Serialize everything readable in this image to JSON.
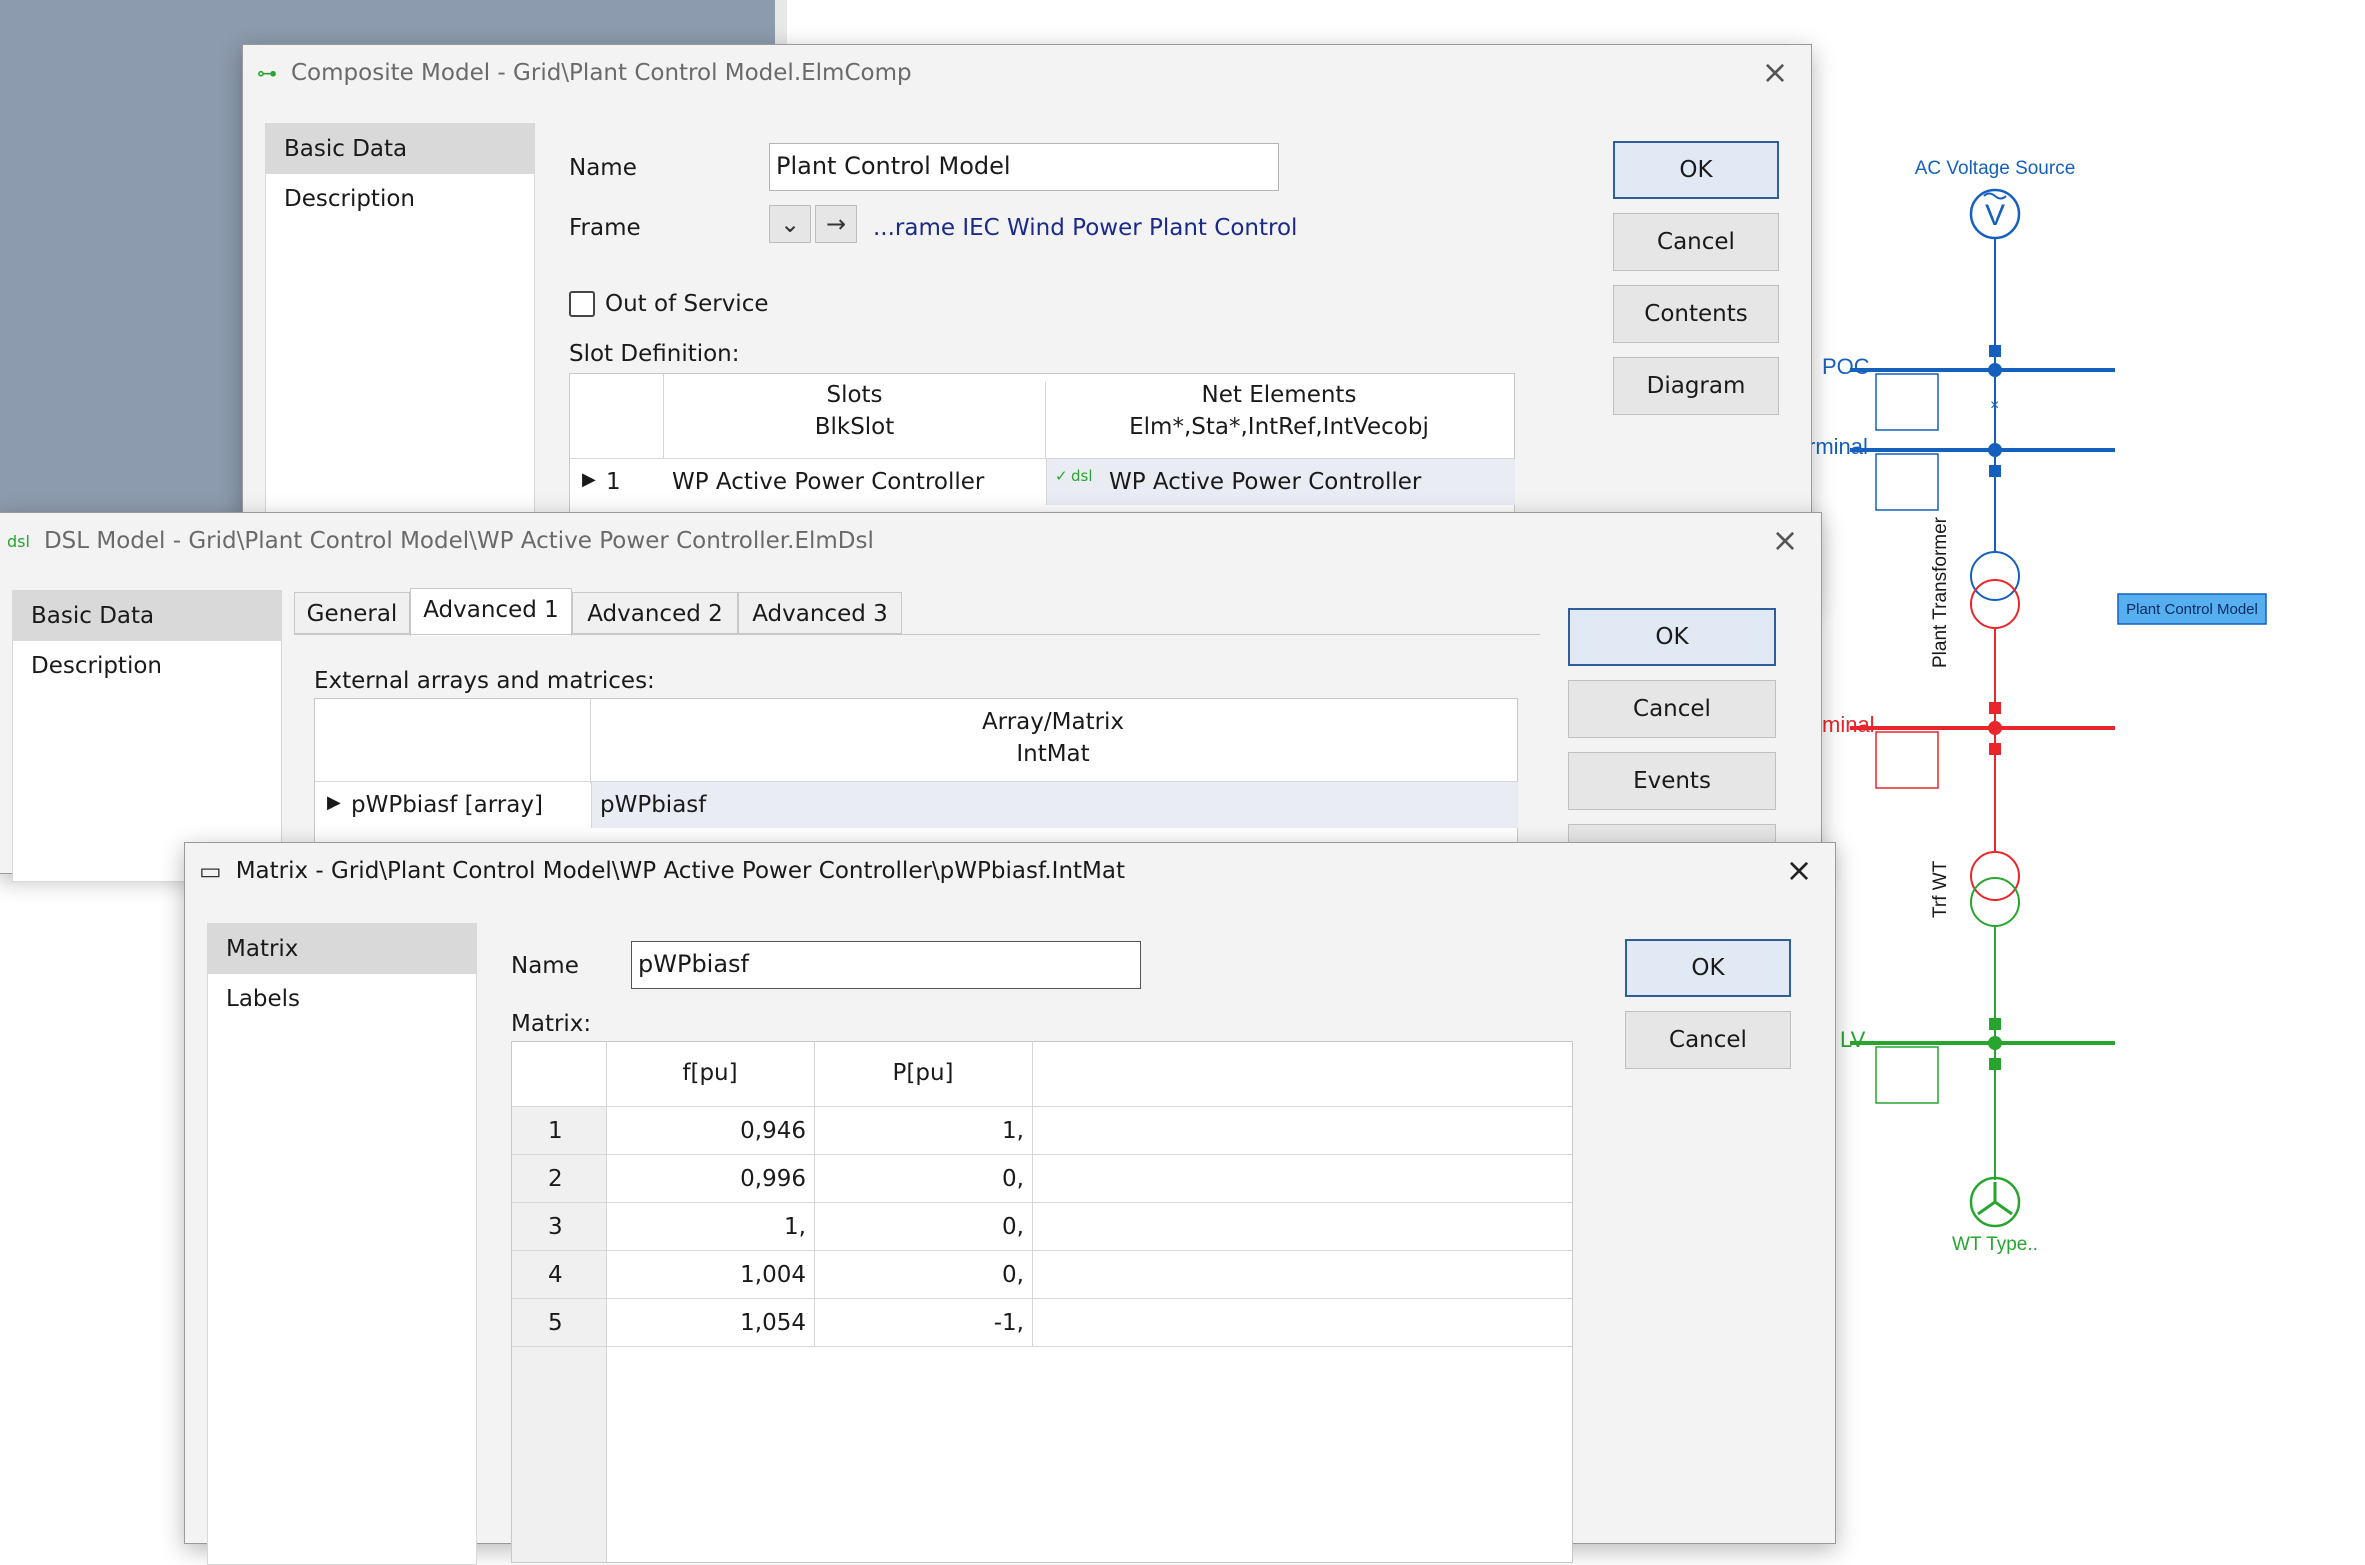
{
  "diagram": {
    "source_label": "AC Voltage Source",
    "source_symbol": "V",
    "bus_poc": "POC",
    "bus_terminal_1": "rminal",
    "transformer_1": "Plant Transformer",
    "bus_terminal_2": "minal",
    "transformer_2": "Trf WT",
    "bus_lv": "LV",
    "generator_label": "WT Type..",
    "plant_control_label": "Plant Control Model",
    "colors": {
      "blue": "#1560bd",
      "red": "#e8262b",
      "green": "#27a52f"
    }
  },
  "composite_window": {
    "title": "Composite Model - Grid\\Plant Control Model.ElmComp",
    "nav": [
      "Basic Data",
      "Description"
    ],
    "name_label": "Name",
    "name_value": "Plant Control Model",
    "frame_label": "Frame",
    "frame_link": "...rame IEC Wind Power Plant Control",
    "out_of_service_label": "Out of Service",
    "slot_definition_label": "Slot Definition:",
    "slot_headers": {
      "slots": "Slots",
      "slots_type": "BlkSlot",
      "net": "Net Elements",
      "net_type": "Elm*,Sta*,IntRef,IntVecobj"
    },
    "slot_rows": [
      {
        "index": "1",
        "slot": "WP Active Power Controller",
        "tag": "dsl",
        "net": "WP Active Power Controller"
      }
    ],
    "buttons": {
      "ok": "OK",
      "cancel": "Cancel",
      "contents": "Contents",
      "diagram": "Diagram"
    }
  },
  "dsl_window": {
    "icon_text": "dsl",
    "title": "DSL Model - Grid\\Plant Control Model\\WP Active Power Controller.ElmDsl",
    "nav": [
      "Basic Data",
      "Description"
    ],
    "tabs": [
      "General",
      "Advanced 1",
      "Advanced 2",
      "Advanced 3"
    ],
    "selected_tab": "Advanced 1",
    "external_label": "External arrays and matrices:",
    "header": {
      "col": "Array/Matrix",
      "type": "IntMat"
    },
    "rows": [
      {
        "name": "pWPbiasf [array]",
        "value": "pWPbiasf"
      }
    ],
    "buttons": {
      "ok": "OK",
      "cancel": "Cancel",
      "events": "Events"
    }
  },
  "matrix_window": {
    "title": "Matrix - Grid\\Plant Control Model\\WP Active Power Controller\\pWPbiasf.IntMat",
    "nav": [
      "Matrix",
      "Labels"
    ],
    "name_label": "Name",
    "name_value": "pWPbiasf",
    "matrix_label": "Matrix:",
    "columns": [
      "f[pu]",
      "P[pu]"
    ],
    "rows": [
      {
        "idx": "1",
        "f": "0,946",
        "p": "1,"
      },
      {
        "idx": "2",
        "f": "0,996",
        "p": "0,"
      },
      {
        "idx": "3",
        "f": "1,",
        "p": "0,"
      },
      {
        "idx": "4",
        "f": "1,004",
        "p": "0,"
      },
      {
        "idx": "5",
        "f": "1,054",
        "p": "-1,"
      }
    ],
    "buttons": {
      "ok": "OK",
      "cancel": "Cancel"
    }
  }
}
